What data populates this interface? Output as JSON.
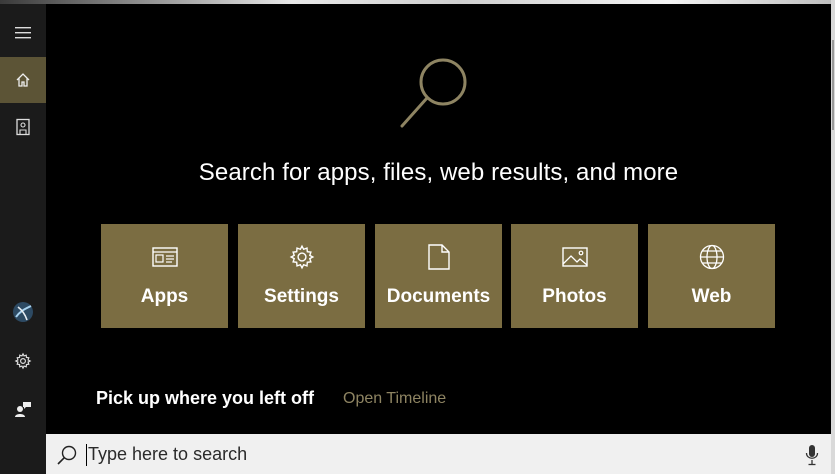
{
  "sidebar": {
    "items": [
      {
        "icon": "hamburger-menu-icon"
      },
      {
        "icon": "home-icon",
        "active": true
      },
      {
        "icon": "notebook-icon"
      },
      {
        "icon": "avatar-icon"
      },
      {
        "icon": "gear-icon"
      },
      {
        "icon": "feedback-icon"
      }
    ]
  },
  "main": {
    "headline": "Search for apps, files, web results, and more",
    "tiles": [
      {
        "label": "Apps",
        "icon": "apps-icon"
      },
      {
        "label": "Settings",
        "icon": "gear-icon"
      },
      {
        "label": "Documents",
        "icon": "document-icon"
      },
      {
        "label": "Photos",
        "icon": "photo-icon"
      },
      {
        "label": "Web",
        "icon": "globe-icon"
      }
    ],
    "pickup_title": "Pick up where you left off",
    "timeline_link": "Open Timeline"
  },
  "search": {
    "placeholder": "Type here to search",
    "value": ""
  },
  "colors": {
    "accent": "#7b6d42",
    "sidebar_active": "#5c5436",
    "link": "#8e8462"
  }
}
